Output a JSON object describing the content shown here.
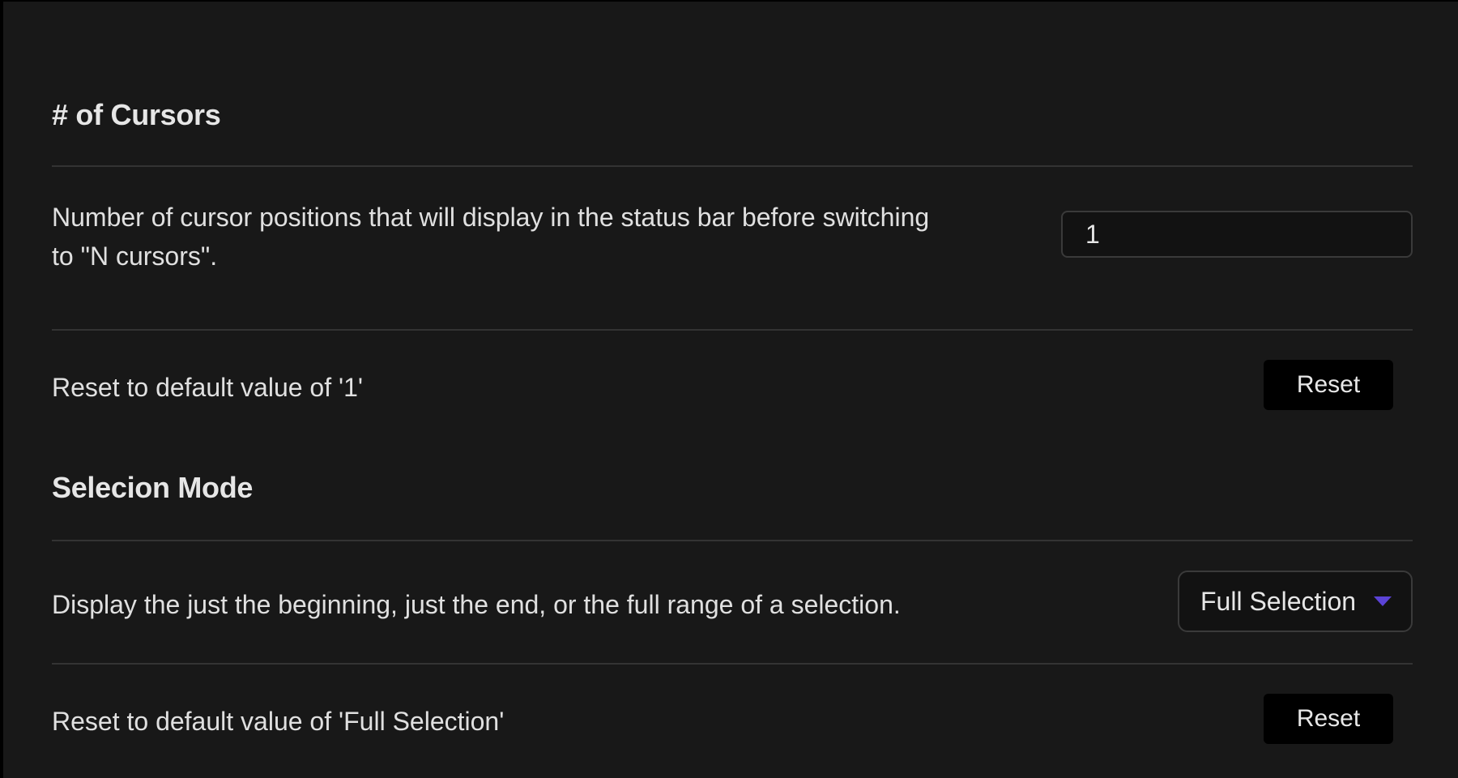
{
  "cursors_section": {
    "title": "# of Cursors",
    "description_line1": "Number of cursor positions that will display in the status bar before switching",
    "description_line2": "to \"N cursors\".",
    "input_value": "1",
    "reset_description": "Reset to default value of '1'",
    "reset_label": "Reset"
  },
  "selection_section": {
    "title": "Selecion Mode",
    "description": "Display the just the beginning, just the end, or the full range of a selection.",
    "selected_option": "Full Selection",
    "reset_description": "Reset to default value of 'Full Selection'",
    "reset_label": "Reset"
  },
  "colors": {
    "background": "#181818",
    "accent": "#5b43d6",
    "button": "#000000"
  },
  "icons": {
    "dropdown": "chevron-down-icon"
  }
}
